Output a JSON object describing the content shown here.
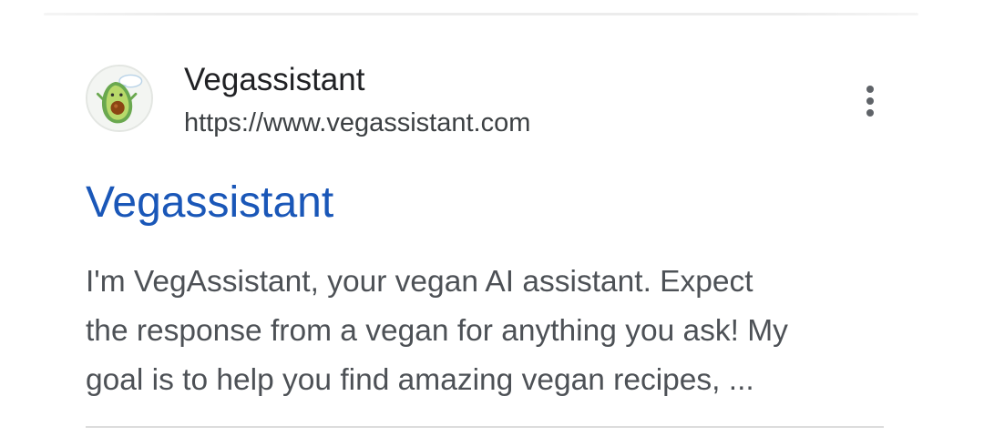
{
  "result": {
    "site_name": "Vegassistant",
    "site_url": "https://www.vegassistant.com",
    "site_icon": "avocado-icon",
    "more_icon": "more-vert-icon",
    "title": "Vegassistant",
    "snippet_lines": [
      "I'm VegAssistant, your vegan AI assistant. Expect",
      "the response from a vegan for anything you ask! My",
      "goal is to help you find amazing vegan recipes, ..."
    ]
  },
  "colors": {
    "title_link": "#1a57b8",
    "site_name": "#202124",
    "snippet": "#4d5156",
    "avocado_skin": "#6aa84f",
    "avocado_pit": "#8b4513"
  }
}
